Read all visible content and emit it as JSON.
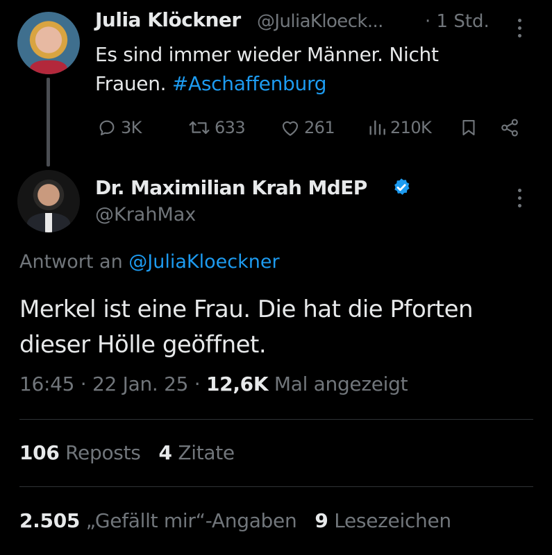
{
  "colors": {
    "background": "#000000",
    "text_primary": "#e7e9ea",
    "text_secondary": "#71767b",
    "accent": "#1d9bf0",
    "divider": "#2f3336"
  },
  "parent_tweet": {
    "author_name": "Julia Klöckner",
    "handle": "@JuliaKloeck...",
    "time": "· 1 Std.",
    "text": "Es sind immer wieder Männer. Nicht Frauen. ",
    "hashtag": "#Aschaffenburg",
    "actions": {
      "replies": "3K",
      "reposts": "633",
      "likes": "261",
      "views": "210K"
    },
    "icons": [
      "reply-icon",
      "repost-icon",
      "like-icon",
      "views-icon",
      "bookmark-icon",
      "share-icon",
      "more-icon"
    ]
  },
  "tweet": {
    "author_name": "Dr. Maximilian Krah MdEP",
    "verified": true,
    "handle": "@KrahMax",
    "reply_to_label": "Antwort an ",
    "reply_to_handle": "@JuliaKloeckner",
    "text": "Merkel ist eine Frau. Die hat die Pforten dieser Hölle geöffnet.",
    "time": "16:45",
    "date": "22 Jan. 25",
    "separator": " · ",
    "views_count": "12,6K",
    "views_label": " Mal angezeigt"
  },
  "stats": {
    "reposts_count": "106",
    "reposts_label": " Reposts",
    "quotes_count": "4",
    "quotes_label": " Zitate",
    "likes_count": "2.505",
    "likes_label": " „Gefällt mir“-Angaben",
    "bookmarks_count": "9",
    "bookmarks_label": " Lesezeichen"
  }
}
